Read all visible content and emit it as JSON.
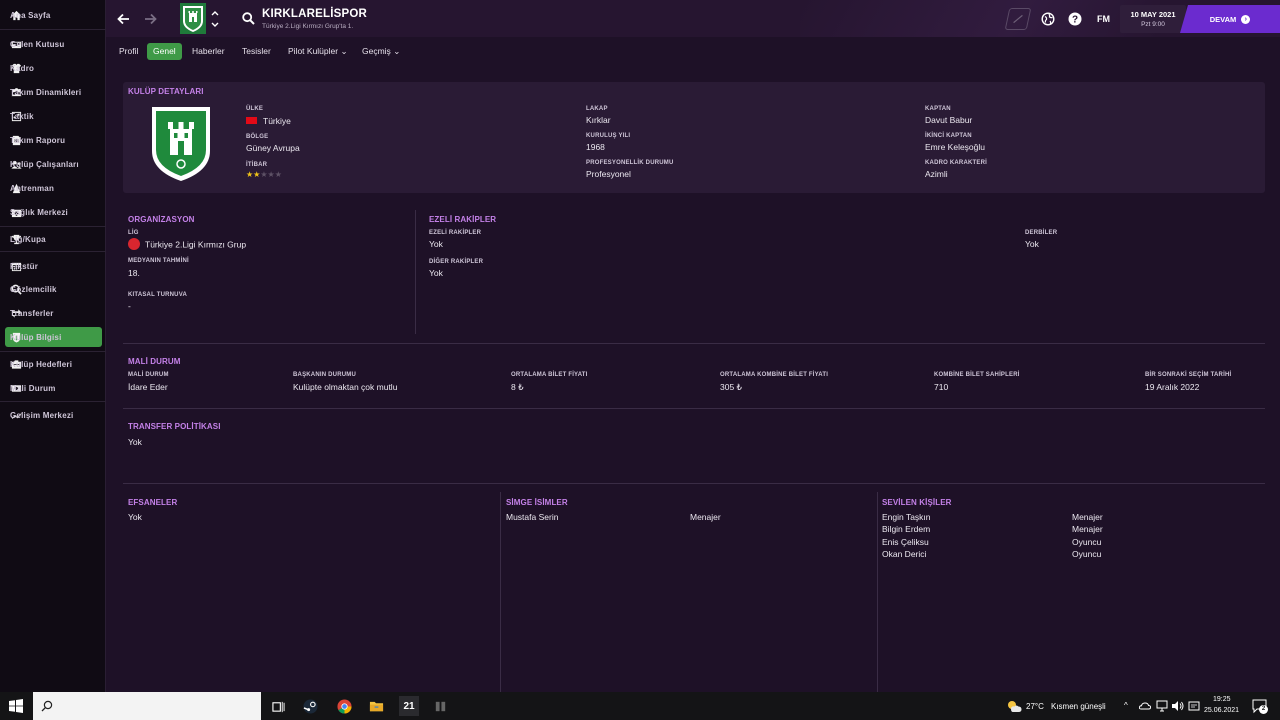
{
  "sidebar": {
    "items": [
      {
        "label": "Ana Sayfa",
        "icon": "home-icon"
      },
      {
        "label": "Gelen Kutusu",
        "icon": "inbox-icon"
      },
      {
        "label": "Kadro",
        "icon": "squad-icon"
      },
      {
        "label": "Takım Dinamikleri",
        "icon": "dynamics-icon"
      },
      {
        "label": "Taktik",
        "icon": "tactics-icon"
      },
      {
        "label": "Takım Raporu",
        "icon": "report-icon"
      },
      {
        "label": "Kulüp Çalışanları",
        "icon": "staff-icon"
      },
      {
        "label": "Antrenman",
        "icon": "training-icon"
      },
      {
        "label": "Sağlık Merkezi",
        "icon": "medical-icon"
      },
      {
        "label": "Lig/Kupa",
        "icon": "trophy-icon"
      },
      {
        "label": "Fikstür",
        "icon": "calendar-icon"
      },
      {
        "label": "Gözlemcilik",
        "icon": "scouting-icon"
      },
      {
        "label": "Transferler",
        "icon": "transfers-icon"
      },
      {
        "label": "Kulüp Bilgisi",
        "icon": "club-info-icon"
      },
      {
        "label": "Kulüp Hedefleri",
        "icon": "objectives-icon"
      },
      {
        "label": "Mali Durum",
        "icon": "finance-icon"
      },
      {
        "label": "Gelişim Merkezi",
        "icon": "development-icon"
      }
    ],
    "active_index": 13
  },
  "header": {
    "club_name": "KIRKLARELİSPOR",
    "club_subtitle": "Türkiye 2.Ligi Kırmızı Grup'ta 1.",
    "fm_label": "FM",
    "date": "10 MAY 2021",
    "day_time": "Pzt 9:00",
    "continue_label": "DEVAM",
    "accent_color": "#6b2bcf"
  },
  "tabs": [
    {
      "label": "Profil"
    },
    {
      "label": "Genel"
    },
    {
      "label": "Haberler"
    },
    {
      "label": "Tesisler"
    },
    {
      "label": "Pilot Kulüpler"
    },
    {
      "label": "Geçmiş"
    }
  ],
  "club_details": {
    "title": "KULÜP DETAYLARI",
    "country_label": "ÜLKE",
    "country": "Türkiye",
    "region_label": "BÖLGE",
    "region": "Güney Avrupa",
    "reputation_label": "İTİBAR",
    "reputation_stars": 2,
    "reputation_max": 5,
    "nickname_label": "LAKAP",
    "nickname": "Kırklar",
    "founded_label": "KURULUŞ YILI",
    "founded": "1968",
    "pro_status_label": "PROFESYONELLİK DURUMU",
    "pro_status": "Profesyonel",
    "captain_label": "KAPTAN",
    "captain": "Davut Babur",
    "vice_captain_label": "İKİNCİ KAPTAN",
    "vice_captain": "Emre Keleşoğlu",
    "character_label": "KADRO KARAKTERİ",
    "character": "Azimli"
  },
  "organization": {
    "title": "ORGANİZASYON",
    "league_label": "LİG",
    "league": "Türkiye 2.Ligi Kırmızı Grup",
    "media_label": "MEDYANIN TAHMİNİ",
    "media": "18.",
    "continental_label": "KITASAL TURNUVA",
    "continental": "-"
  },
  "rivals": {
    "title": "EZELİ RAKİPLER",
    "arch_label": "EZELİ RAKİPLER",
    "arch": "Yok",
    "other_label": "DİĞER RAKİPLER",
    "other": "Yok",
    "derby_label": "DERBİLER",
    "derby": "Yok"
  },
  "finance": {
    "title": "MALİ DURUM",
    "columns": [
      {
        "label": "MALİ DURUM",
        "value": "İdare Eder"
      },
      {
        "label": "BAŞKANIN DURUMU",
        "value": "Kulüpte olmaktan çok mutlu"
      },
      {
        "label": "ORTALAMA BİLET FİYATI",
        "value": "8 ₺"
      },
      {
        "label": "ORTALAMA KOMBİNE BİLET FİYATI",
        "value": "305 ₺"
      },
      {
        "label": "KOMBİNE BİLET SAHİPLERİ",
        "value": "710"
      },
      {
        "label": "BİR SONRAKİ SEÇİM TARİHİ",
        "value": "19 Aralık 2022"
      }
    ]
  },
  "transfer_policy": {
    "title": "TRANSFER POLİTİKASI",
    "value": "Yok"
  },
  "legends": {
    "title": "EFSANELER",
    "value": "Yok"
  },
  "icons_people": {
    "title": "SİMGE İSİMLER",
    "rows": [
      {
        "name": "Mustafa Serin",
        "role": "Menajer"
      }
    ]
  },
  "favourites": {
    "title": "SEVİLEN KİŞİLER",
    "rows": [
      {
        "name": "Engin Taşkın",
        "role": "Menajer"
      },
      {
        "name": "Bilgin Erdem",
        "role": "Menajer"
      },
      {
        "name": "Enis Çeliksu",
        "role": "Oyuncu"
      },
      {
        "name": "Okan Derici",
        "role": "Oyuncu"
      }
    ]
  },
  "taskbar": {
    "temperature": "27°C",
    "weather": "Kısmen güneşli",
    "time": "19:25",
    "date": "25.06.2021",
    "app_badge": "21",
    "notification_count": "2"
  }
}
